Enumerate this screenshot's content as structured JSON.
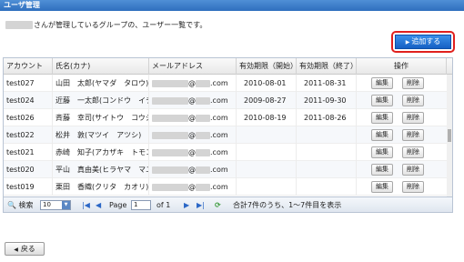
{
  "window": {
    "title": "ユーザ管理"
  },
  "description": "さんが管理しているグループの、ユーザー一覧です。",
  "add_button": {
    "label": "追加する"
  },
  "table": {
    "headers": [
      "アカウント",
      "氏名(カナ)",
      "メールアドレス",
      "有効期限（開始）",
      "有効期限（終了）",
      "操作"
    ],
    "rows": [
      {
        "account": "test027",
        "name": "山田　太郎(ヤマダ　タロウ)",
        "email_suffix": "@",
        "email_domain": ".com",
        "start": "2010-08-01",
        "end": "2011-08-31"
      },
      {
        "account": "test024",
        "name": "近藤　一太郎(コンドウ　イチタ",
        "email_suffix": "@",
        "email_domain": ".com",
        "start": "2009-08-27",
        "end": "2011-09-30"
      },
      {
        "account": "test026",
        "name": "斉藤　幸司(サイトウ　コウジ)",
        "email_suffix": "@",
        "email_domain": ".com",
        "start": "2010-08-19",
        "end": "2011-08-26"
      },
      {
        "account": "test022",
        "name": "松井　敦(マツイ　アツシ)",
        "email_suffix": "@",
        "email_domain": ".com",
        "start": "",
        "end": ""
      },
      {
        "account": "test021",
        "name": "赤崎　知子(アカザキ　トモコ)",
        "email_suffix": "@",
        "email_domain": ".com",
        "start": "",
        "end": ""
      },
      {
        "account": "test020",
        "name": "平山　真由美(ヒラヤマ　マユミ",
        "email_suffix": "@",
        "email_domain": ".com",
        "start": "",
        "end": ""
      },
      {
        "account": "test019",
        "name": "栗田　香織(クリタ　カオリ)",
        "email_suffix": "@",
        "email_domain": ".com",
        "start": "",
        "end": ""
      }
    ],
    "edit_label": "編集",
    "delete_label": "削除"
  },
  "pager": {
    "search_label": "検索",
    "page_size": "10",
    "page_label": "Page",
    "page_value": "1",
    "of_label": "of 1",
    "summary": "合計7件のうち、1〜7件目を表示"
  },
  "back_button": {
    "label": "戻る"
  },
  "colors": {
    "accent": "#2f6fbe",
    "highlight": "#e0201d"
  }
}
